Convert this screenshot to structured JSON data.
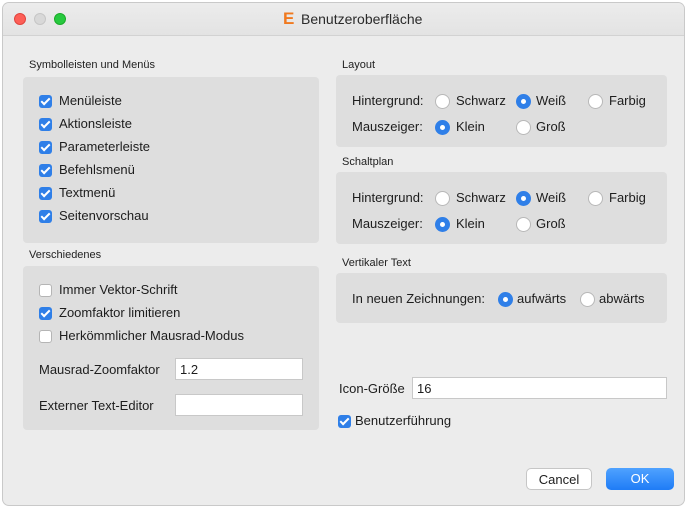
{
  "window": {
    "title": "Benutzeroberfläche",
    "app_icon_glyph": "E",
    "app_icon_color": "#f0791f"
  },
  "toolbars": {
    "heading": "Symbolleisten und Menüs",
    "items": [
      {
        "label": "Menüleiste",
        "checked": true
      },
      {
        "label": "Aktionsleiste",
        "checked": true
      },
      {
        "label": "Parameterleiste",
        "checked": true
      },
      {
        "label": "Befehlsmenü",
        "checked": true
      },
      {
        "label": "Textmenü",
        "checked": true
      },
      {
        "label": "Seitenvorschau",
        "checked": true
      }
    ]
  },
  "misc": {
    "heading": "Verschiedenes",
    "items": [
      {
        "label": "Immer Vektor-Schrift",
        "checked": false
      },
      {
        "label": "Zoomfaktor limitieren",
        "checked": true
      },
      {
        "label": "Herkömmlicher Mausrad-Modus",
        "checked": false
      }
    ],
    "zoom_label": "Mausrad-Zoomfaktor",
    "zoom_value": "1.2",
    "editor_label": "Externer Text-Editor",
    "editor_value": ""
  },
  "layout": {
    "heading": "Layout",
    "background_label": "Hintergrund:",
    "background_options": [
      "Schwarz",
      "Weiß",
      "Farbig"
    ],
    "background_selected": "Weiß",
    "cursor_label": "Mauszeiger:",
    "cursor_options": [
      "Klein",
      "Groß"
    ],
    "cursor_selected": "Klein"
  },
  "schematic": {
    "heading": "Schaltplan",
    "background_label": "Hintergrund:",
    "background_options": [
      "Schwarz",
      "Weiß",
      "Farbig"
    ],
    "background_selected": "Weiß",
    "cursor_label": "Mauszeiger:",
    "cursor_options": [
      "Klein",
      "Groß"
    ],
    "cursor_selected": "Klein"
  },
  "vertical_text": {
    "heading": "Vertikaler Text",
    "label": "In neuen Zeichnungen:",
    "options": [
      "aufwärts",
      "abwärts"
    ],
    "selected": "aufwärts"
  },
  "icon_size": {
    "label": "Icon-Größe",
    "value": "16"
  },
  "guidance": {
    "label": "Benutzerführung",
    "checked": true
  },
  "buttons": {
    "cancel": "Cancel",
    "ok": "OK"
  },
  "colors": {
    "accent": "#2f7fe8",
    "window_bg": "#ececec",
    "panel_bg": "#dedede"
  }
}
